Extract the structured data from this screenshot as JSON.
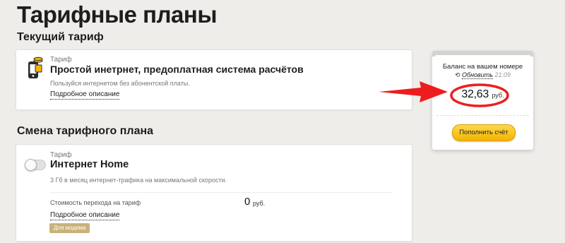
{
  "page": {
    "title": "Тарифные планы"
  },
  "current_tariff": {
    "heading": "Текущий тариф",
    "label": "Тариф",
    "name": "Простой инетрнет, предоплатная система расчётов",
    "description": "Пользуйся интернетом без абонентской платы.",
    "details_link": "Подробное описание",
    "icon": "phone-with-coins-icon"
  },
  "change_tariff": {
    "heading": "Смена тарифного плана",
    "label": "Тариф",
    "name": "Интернет Home",
    "description": "3 Гб в месяц интернет-трафика на максимальной скорости.",
    "switch_cost_label": "Стоимость перехода на тариф",
    "switch_cost_value": "0",
    "switch_cost_unit": "руб.",
    "details_link": "Подробное описание",
    "badge": "Для модема",
    "toggle_on": false
  },
  "balance": {
    "title": "Баланс на вашем номере",
    "refresh_link": "Обновить",
    "refresh_time": "21:09",
    "amount": "32,63",
    "unit": "руб.",
    "topup_button": "Пополнить счёт"
  },
  "colors": {
    "background": "#efedea",
    "accent_yellow": "#f3b400",
    "annotation_red": "#ee1d1d",
    "badge": "#c9b27a"
  }
}
